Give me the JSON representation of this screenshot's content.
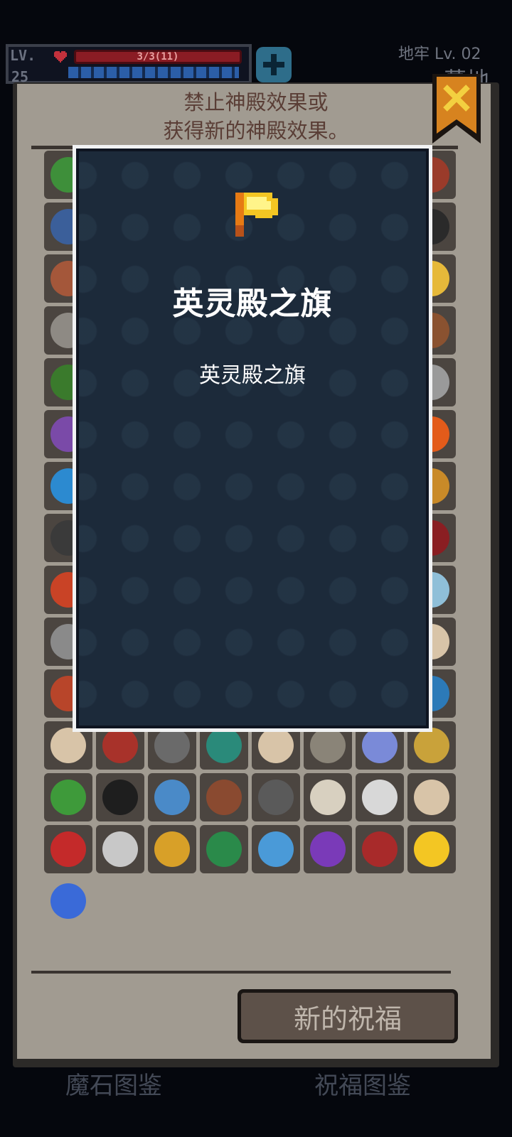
{
  "hud": {
    "level_label": "LV.",
    "level_value": "25",
    "hp_text": "3/3(11)"
  },
  "dungeon": {
    "level": "地牢 Lv. 02",
    "name": "墓地"
  },
  "panel": {
    "header": "禁止神殿效果或\n获得新的神殿效果。",
    "new_blessing_button": "新的祝福"
  },
  "bottom_tabs": {
    "left": "魔石图鉴",
    "right": "祝福图鉴"
  },
  "detail": {
    "icon": "golden-flag-icon",
    "title": "英灵殿之旗",
    "description": "英灵殿之旗"
  },
  "colors": {
    "panel_bg": "#a19b91",
    "tile_bg": "#4b4540",
    "overlay_bg": "#1c2a3a",
    "header_text": "#5a3e36",
    "flag_gold": "#f3c623"
  },
  "grid_icons": [
    "leaf-icon",
    "ghost",
    "ghost",
    "ghost",
    "ghost",
    "ghost",
    "ghost",
    "sword-icon",
    "shield-icon",
    "ghost",
    "ghost",
    "ghost",
    "ghost",
    "ghost",
    "ghost",
    "chest-icon",
    "arm-icon",
    "ghost",
    "ghost",
    "ghost",
    "ghost",
    "ghost",
    "ghost",
    "egg-icon",
    "claw-icon",
    "ghost",
    "ghost",
    "ghost",
    "ghost",
    "ghost",
    "ghost",
    "book-icon",
    "plant-icon",
    "ghost",
    "ghost",
    "ghost",
    "ghost",
    "ghost",
    "ghost",
    "bag-icon",
    "wing-icon",
    "ghost",
    "ghost",
    "ghost",
    "ghost",
    "ghost",
    "ghost",
    "fire-icon",
    "orb-icon",
    "ghost",
    "ghost",
    "ghost",
    "ghost",
    "ghost",
    "ghost",
    "mask-icon",
    "cannon-icon",
    "ghost",
    "ghost",
    "ghost",
    "ghost",
    "ghost",
    "ghost",
    "rune-icon",
    "flame-icon",
    "ghost",
    "ghost",
    "ghost",
    "ghost",
    "ghost",
    "ghost",
    "ghost-icon",
    "cog-icon",
    "ghost",
    "ghost",
    "ghost",
    "ghost",
    "ghost",
    "ghost",
    "no-icon",
    "torch-icon",
    "ghost",
    "ghost",
    "ghost",
    "ghost",
    "ghost",
    "ghost",
    "potion-icon",
    "no-icon",
    "hammer-icon",
    "gear-icon",
    "mushroom-icon",
    "no-icon",
    "scroll-icon",
    "planet-icon",
    "staff-icon",
    "heart-cycle-icon",
    "bottle-icon",
    "flask-icon",
    "box-icon",
    "dagger-icon",
    "card-icon",
    "spade-card-icon",
    "no-icon",
    "wand-icon",
    "bone-icon",
    "diamond-icon",
    "green-orb-icon",
    "blue-axe-icon",
    "purple-axe-icon",
    "armor-icon",
    "golden-flag-icon",
    "banned-item-icon"
  ]
}
